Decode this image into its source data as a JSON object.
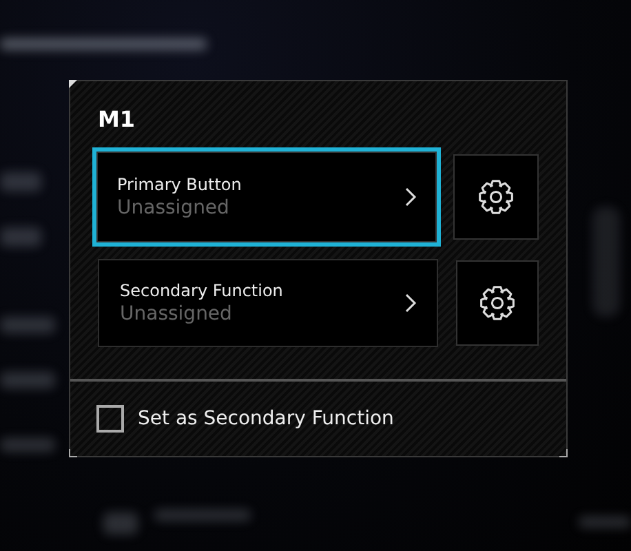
{
  "dialog": {
    "title": "M1",
    "rows": [
      {
        "label": "Primary Button",
        "value": "Unassigned",
        "selected": true
      },
      {
        "label": "Secondary Function",
        "value": "Unassigned",
        "selected": false
      }
    ],
    "checkbox": {
      "label": "Set as Secondary Function",
      "checked": false
    }
  }
}
